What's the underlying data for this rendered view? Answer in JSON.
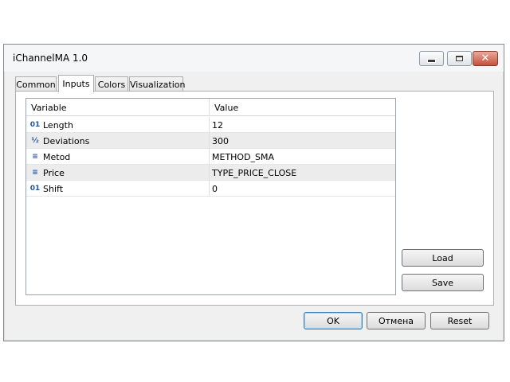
{
  "window": {
    "title": "iChannelMA 1.0"
  },
  "tabs": [
    {
      "label": "Common",
      "active": false
    },
    {
      "label": "Inputs",
      "active": true
    },
    {
      "label": "Colors",
      "active": false
    },
    {
      "label": "Visualization",
      "active": false
    }
  ],
  "grid": {
    "columns": [
      "Variable",
      "Value"
    ],
    "rows": [
      {
        "icon": "integer-icon",
        "glyph": "01",
        "variable": "Length",
        "value": "12"
      },
      {
        "icon": "fraction-icon",
        "glyph": "½",
        "variable": "Deviations",
        "value": "300"
      },
      {
        "icon": "enum-icon",
        "glyph": "≡",
        "variable": "Metod",
        "value": "METHOD_SMA"
      },
      {
        "icon": "enum-icon",
        "glyph": "≡",
        "variable": "Price",
        "value": "TYPE_PRICE_CLOSE"
      },
      {
        "icon": "integer-icon",
        "glyph": "01",
        "variable": "Shift",
        "value": "0"
      }
    ]
  },
  "side_buttons": {
    "load": "Load",
    "save": "Save"
  },
  "footer": {
    "ok": "OK",
    "cancel": "Отмена",
    "reset": "Reset"
  }
}
